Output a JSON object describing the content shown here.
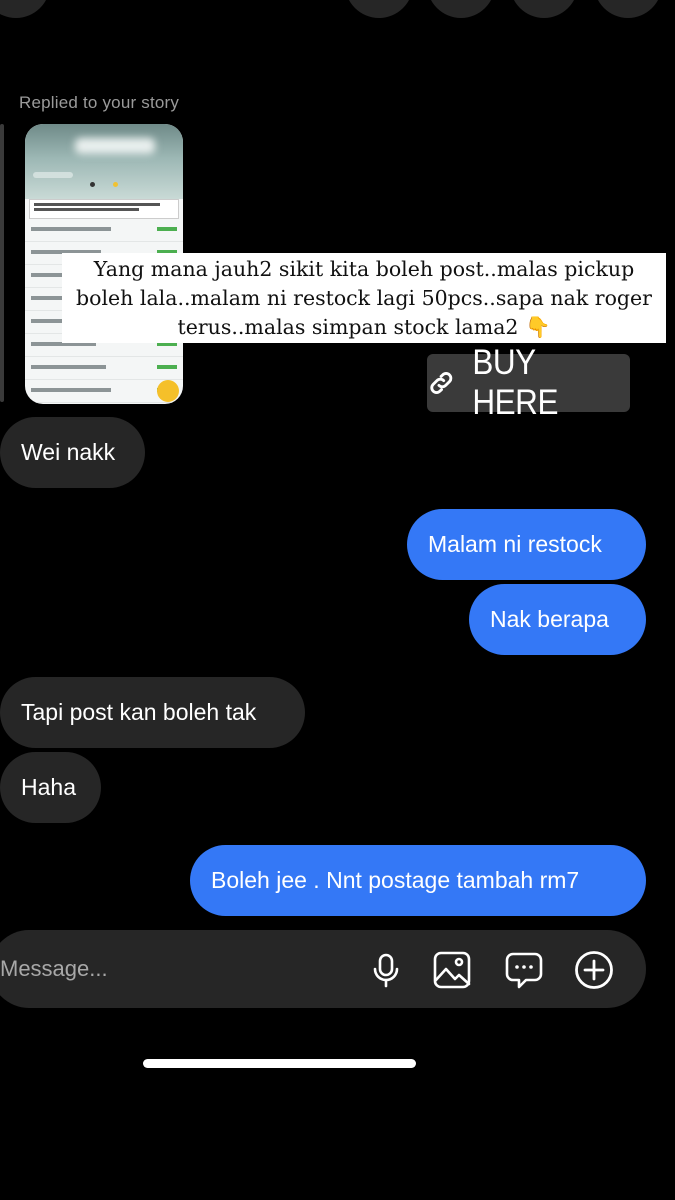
{
  "story_reply": {
    "label": "Replied to your story",
    "caption": "Yang mana jauh2 sikit kita boleh post..malas pickup boleh lala..malam ni restock lagi 50pcs..sapa nak roger terus..malas simpan stock lama2 👇",
    "link_button": "BUY HERE"
  },
  "messages": [
    {
      "side": "in",
      "text": "Wei nakk"
    },
    {
      "side": "out",
      "text": "Malam ni restock"
    },
    {
      "side": "out",
      "text": "Nak berapa"
    },
    {
      "side": "in",
      "text": "Tapi post kan boleh tak"
    },
    {
      "side": "in",
      "text": "Haha"
    },
    {
      "side": "out",
      "text": "Boleh jee . Nnt postage tambah rm7"
    }
  ],
  "composer": {
    "placeholder": "Message...",
    "icons": [
      "microphone-icon",
      "image-icon",
      "sticker-chat-icon",
      "add-circle-icon"
    ]
  },
  "colors": {
    "background": "#000000",
    "incoming_bubble": "#262626",
    "outgoing_bubble": "#3478f6"
  }
}
